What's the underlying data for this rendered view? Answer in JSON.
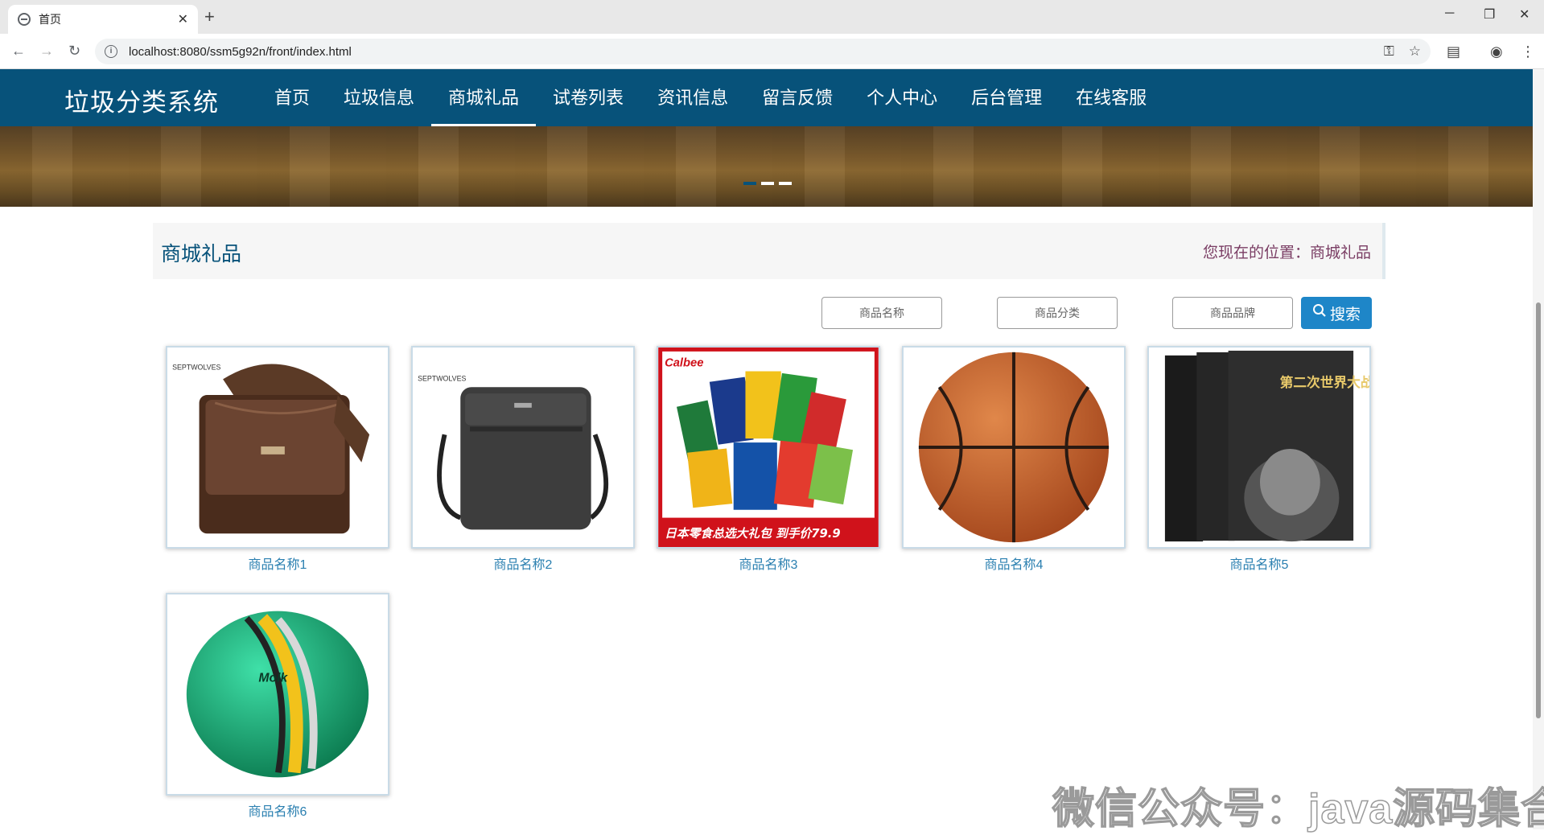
{
  "browser": {
    "tab_title": "首页",
    "tab_close": "✕",
    "new_tab": "+",
    "url": "localhost:8080/ssm5g92n/front/index.html",
    "window_controls": {
      "minimize": "─",
      "restore": "❐",
      "close": "✕"
    }
  },
  "site": {
    "logo": "垃圾分类系统",
    "nav": [
      "首页",
      "垃圾信息",
      "商城礼品",
      "试卷列表",
      "资讯信息",
      "留言反馈",
      "个人中心",
      "后台管理",
      "在线客服"
    ],
    "active_nav_index": 2
  },
  "banner": {
    "slide_count": 3,
    "current_slide": 1
  },
  "page": {
    "title": "商城礼品",
    "breadcrumb_prefix": "您现在的位置：",
    "breadcrumb_current": "商城礼品"
  },
  "search": {
    "name_placeholder": "商品名称",
    "category_placeholder": "商品分类",
    "brand_placeholder": "商品品牌",
    "button_label": "搜索",
    "button_color": "#1e86c8"
  },
  "products": [
    {
      "name": "商品名称1",
      "image": "brown-leather-bag",
      "brand_text": "SEPTWOLVES"
    },
    {
      "name": "商品名称2",
      "image": "grey-shoulder-bag",
      "brand_text": "SEPTWOLVES"
    },
    {
      "name": "商品名称3",
      "image": "calbee-snack-pack",
      "brand_text": "Calbee",
      "caption": "日本零食总选大礼包 到手价79.9"
    },
    {
      "name": "商品名称4",
      "image": "basketball"
    },
    {
      "name": "商品名称5",
      "image": "ww2-memoir-book",
      "book_title": "第二次世界大战回忆录"
    },
    {
      "name": "商品名称6",
      "image": "green-soccer-ball",
      "brand_text": "Molk"
    }
  ],
  "watermark": "微信公众号：java源码集合",
  "colors": {
    "nav_bg": "#07527a",
    "link": "#2a7fb0",
    "breadcrumb": "#7a3d64"
  }
}
